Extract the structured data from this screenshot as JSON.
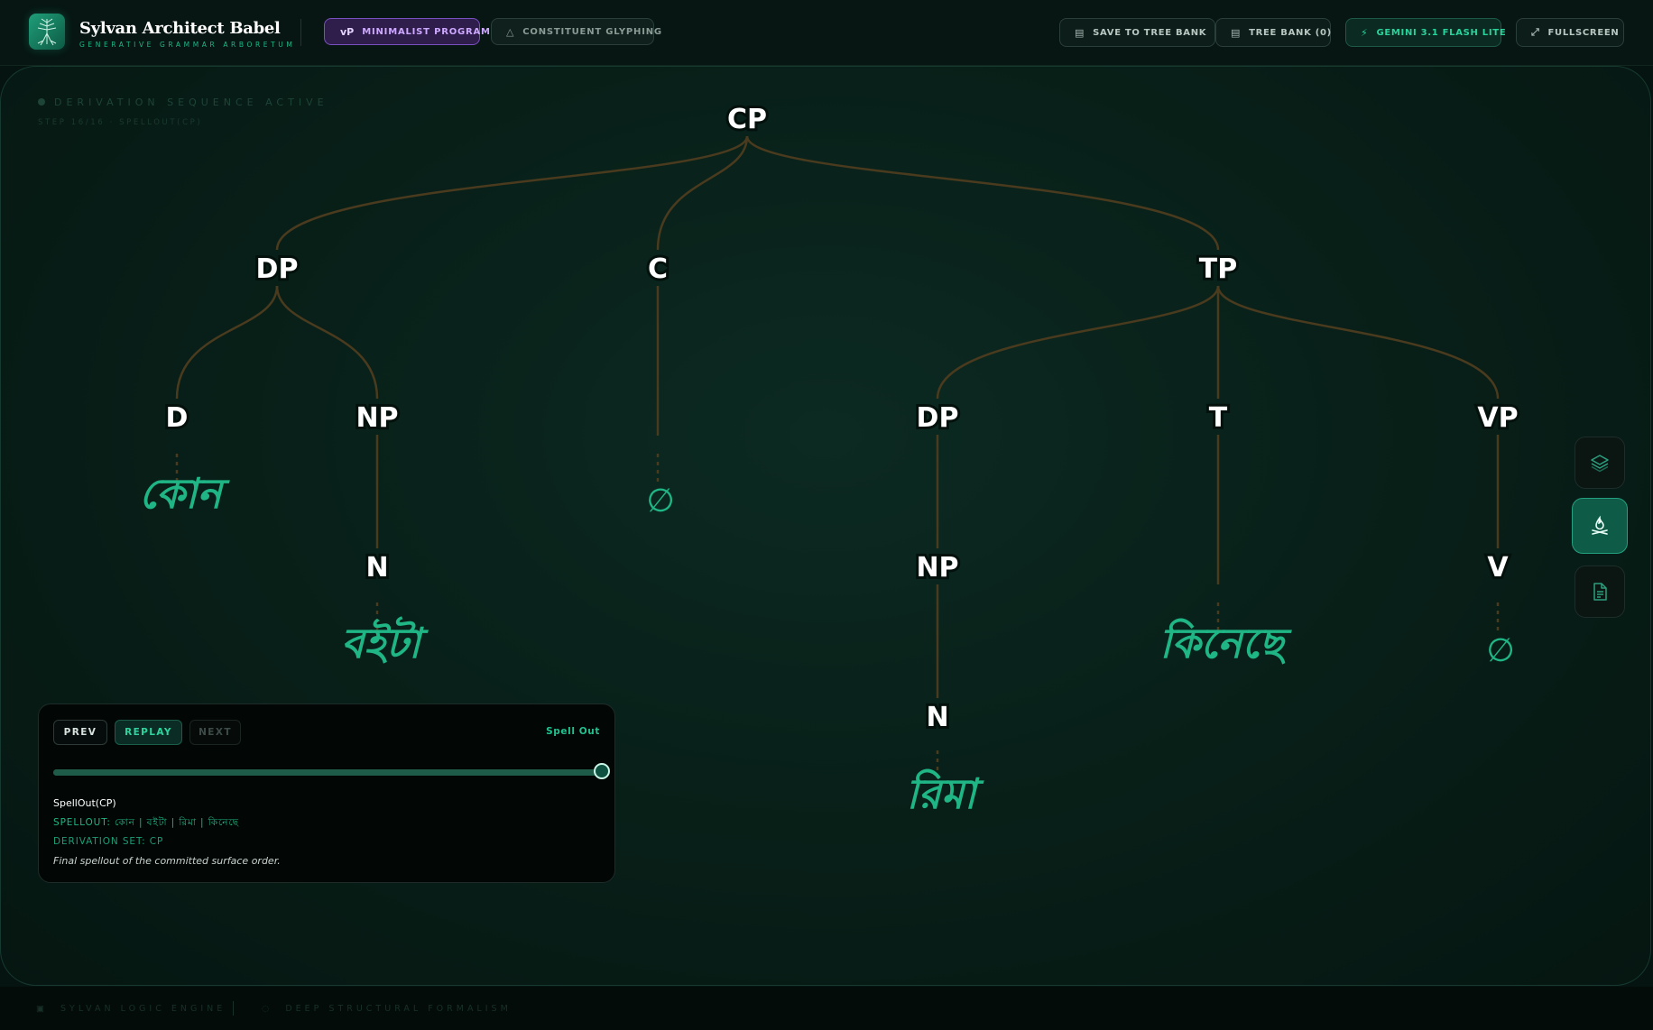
{
  "app": {
    "title": "Sylvan Architect Babel",
    "subtitle": "GENERATIVE GRAMMAR ARBORETUM"
  },
  "header": {
    "modes": [
      {
        "label": "MINIMALIST PROGRAM",
        "icon": "vP",
        "active": true
      },
      {
        "label": "CONSTITUENT GLYPHING",
        "icon": "triangle-icon",
        "active": false
      }
    ],
    "save_label": "SAVE TO TREE BANK",
    "bank_label": "TREE BANK (0)",
    "model_label": "GEMINI 3.1 FLASH LITE",
    "fullscreen_label": "FULLSCREEN"
  },
  "canvas": {
    "status": "DERIVATION SEQUENCE ACTIVE",
    "step": "STEP 16/16 · SPELLOUT(CP)"
  },
  "tree": {
    "nodes": [
      {
        "id": "cp",
        "label": "CP"
      },
      {
        "id": "dp1",
        "label": "DP"
      },
      {
        "id": "c",
        "label": "C"
      },
      {
        "id": "tp",
        "label": "TP"
      },
      {
        "id": "d",
        "label": "D"
      },
      {
        "id": "np1",
        "label": "NP"
      },
      {
        "id": "dp2",
        "label": "DP"
      },
      {
        "id": "t",
        "label": "T"
      },
      {
        "id": "vp",
        "label": "VP"
      },
      {
        "id": "n1",
        "label": "N"
      },
      {
        "id": "np2",
        "label": "NP"
      },
      {
        "id": "v",
        "label": "V"
      },
      {
        "id": "n2",
        "label": "N"
      }
    ],
    "leaves": [
      {
        "id": "leaf-d",
        "text": "কোন"
      },
      {
        "id": "leaf-c",
        "text": "∅"
      },
      {
        "id": "leaf-n1",
        "text": "বইটা"
      },
      {
        "id": "leaf-t",
        "text": "কিনেছে"
      },
      {
        "id": "leaf-v",
        "text": "∅"
      },
      {
        "id": "leaf-n2",
        "text": "রিমা"
      }
    ]
  },
  "panel": {
    "prev_label": "PREV",
    "replay_label": "REPLAY",
    "next_label": "NEXT",
    "mode_tag": "Spell Out",
    "progress": 1.0,
    "step_title": "SpellOut(CP)",
    "spellout": "SPELLOUT: কোন | বইটা | রিমা | কিনেছে",
    "derivation_set": "DERIVATION SET: CP",
    "note": "Final spellout of the committed surface order."
  },
  "footer": {
    "engine": "SYLVAN LOGIC ENGINE",
    "formalism": "DEEP STRUCTURAL FORMALISM"
  },
  "colors": {
    "accent": "#1fb585",
    "branch": "#4a3a1e",
    "mode_active": "#7a4fc0"
  }
}
